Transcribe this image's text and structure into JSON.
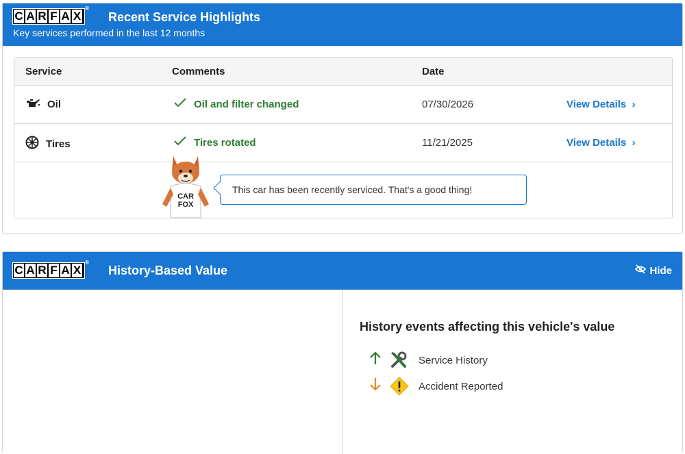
{
  "service_card": {
    "logo_letters": [
      "C",
      "A",
      "R",
      "F",
      "A",
      "X"
    ],
    "logo_reg": "®",
    "title": "Recent Service Highlights",
    "subtitle": "Key services performed in the last 12 months",
    "columns": [
      "Service",
      "Comments",
      "Date"
    ],
    "rows": [
      {
        "icon": "oil-can-icon",
        "service": "Oil",
        "comment": "Oil and filter changed",
        "date": "07/30/2026",
        "link": "View Details"
      },
      {
        "icon": "tire-icon",
        "service": "Tires",
        "comment": "Tires rotated",
        "date": "11/21/2025",
        "link": "View Details"
      }
    ],
    "fox_shirt_line1": "CAR",
    "fox_shirt_line2": "FOX",
    "fox_message": "This car has been recently serviced. That's a good thing!"
  },
  "value_card": {
    "title": "History-Based Value",
    "hide_label": "Hide",
    "events_title": "History events affecting this vehicle's value",
    "events": [
      {
        "direction": "up",
        "color": "#2e7d32",
        "icon": "wrench-screwdriver-icon",
        "label": "Service History"
      },
      {
        "direction": "down",
        "color": "#e8891c",
        "icon": "warning-diamond-icon",
        "label": "Accident Reported"
      }
    ]
  },
  "colors": {
    "brand_blue": "#1976d2",
    "success_green": "#2e7d32",
    "warning_orange": "#e8891c",
    "warning_yellow": "#f5c518"
  }
}
